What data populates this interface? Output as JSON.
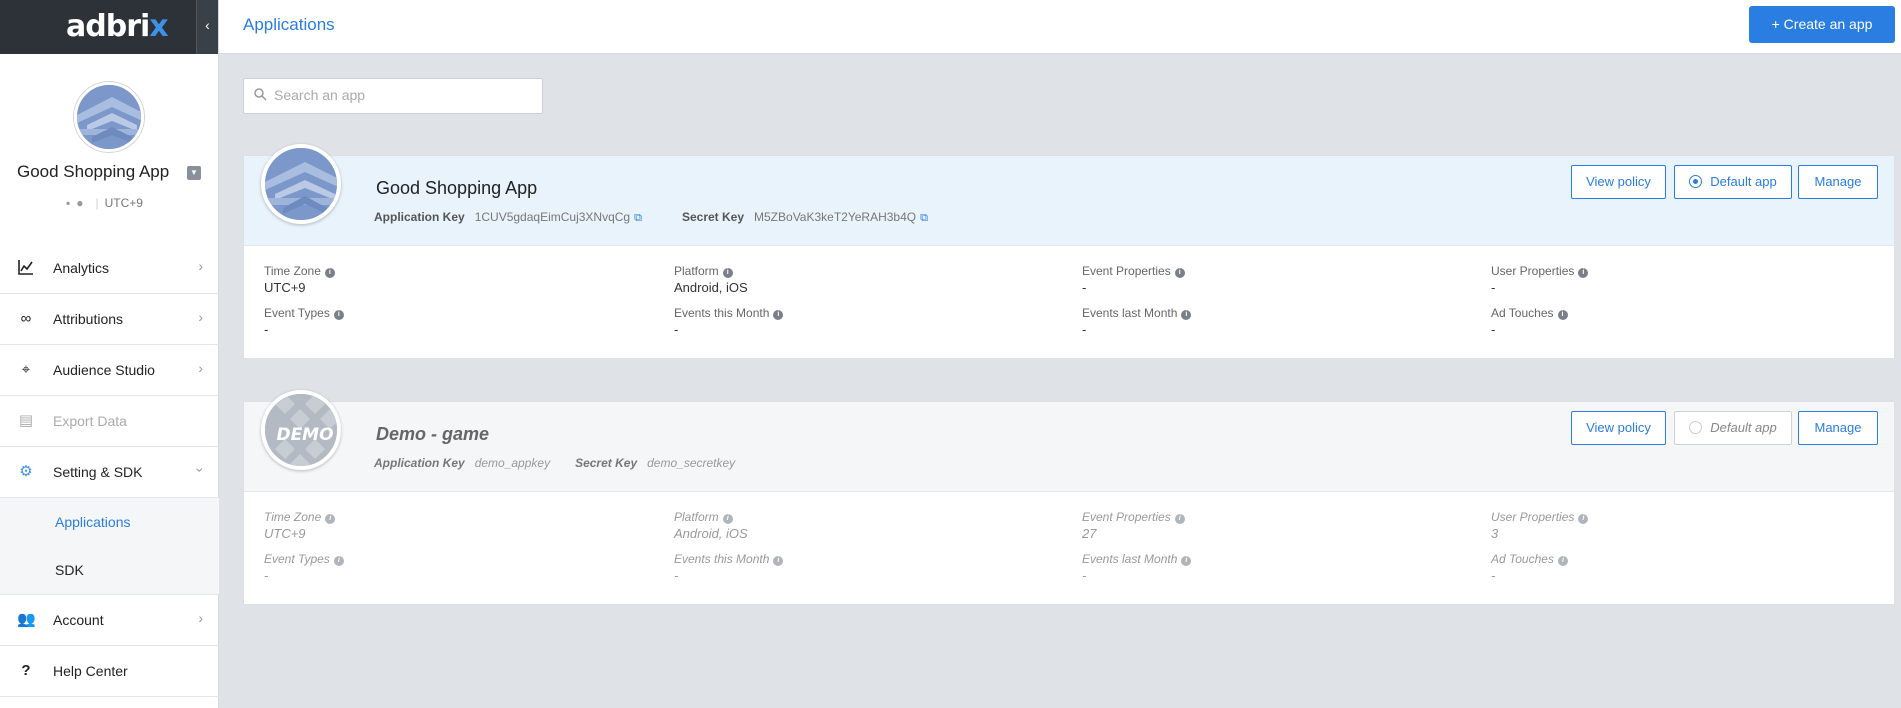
{
  "sidebar": {
    "logo_main": "adbri",
    "logo_x": "x",
    "collapse_icon": "chevron-left-icon",
    "app_name": "Good Shopping App",
    "timezone": "UTC+9",
    "nav": [
      {
        "label": "Analytics",
        "icon": "chart-icon"
      },
      {
        "label": "Attributions",
        "icon": "infinity-icon"
      },
      {
        "label": "Audience Studio",
        "icon": "target-icon"
      },
      {
        "label": "Export Data",
        "icon": "file-export-icon"
      },
      {
        "label": "Setting & SDK",
        "icon": "gear-icon"
      }
    ],
    "sub_nav": [
      {
        "label": "Applications"
      },
      {
        "label": "SDK"
      }
    ],
    "nav_bottom": [
      {
        "label": "Account",
        "icon": "users-icon"
      },
      {
        "label": "Help Center",
        "icon": "question-icon"
      }
    ]
  },
  "header": {
    "title": "Applications",
    "create_button": "Create an app"
  },
  "search": {
    "placeholder": "Search an app"
  },
  "apps": [
    {
      "name": "Good Shopping App",
      "app_key_label": "Application Key",
      "app_key": "1CUV5gdaqEimCuj3XNvqCg",
      "secret_key_label": "Secret Key",
      "secret_key": "M5ZBoVaK3keT2YeRAH3b4Q",
      "view_policy": "View policy",
      "default_app": "Default app",
      "manage": "Manage",
      "stats": [
        {
          "label": "Time Zone",
          "value": "UTC+9"
        },
        {
          "label": "Platform",
          "value": "Android, iOS"
        },
        {
          "label": "Event Properties",
          "value": "-"
        },
        {
          "label": "User Properties",
          "value": "-"
        },
        {
          "label": "Event Types",
          "value": "-"
        },
        {
          "label": "Events this Month",
          "value": "-"
        },
        {
          "label": "Events last Month",
          "value": "-"
        },
        {
          "label": "Ad Touches",
          "value": "-"
        }
      ]
    },
    {
      "name": "Demo - game",
      "avatar_text": "DEMO",
      "app_key_label": "Application Key",
      "app_key": "demo_appkey",
      "secret_key_label": "Secret Key",
      "secret_key": "demo_secretkey",
      "view_policy": "View policy",
      "default_app": "Default app",
      "manage": "Manage",
      "stats": [
        {
          "label": "Time Zone",
          "value": "UTC+9"
        },
        {
          "label": "Platform",
          "value": "Android, iOS"
        },
        {
          "label": "Event Properties",
          "value": "27"
        },
        {
          "label": "User Properties",
          "value": "3"
        },
        {
          "label": "Event Types",
          "value": "-"
        },
        {
          "label": "Events this Month",
          "value": "-"
        },
        {
          "label": "Events last Month",
          "value": "-"
        },
        {
          "label": "Ad Touches",
          "value": "-"
        }
      ]
    }
  ],
  "colors": {
    "accent": "#2a7de1",
    "sidebar_dark": "#2d3238",
    "card_highlight": "#e9f3fc"
  }
}
